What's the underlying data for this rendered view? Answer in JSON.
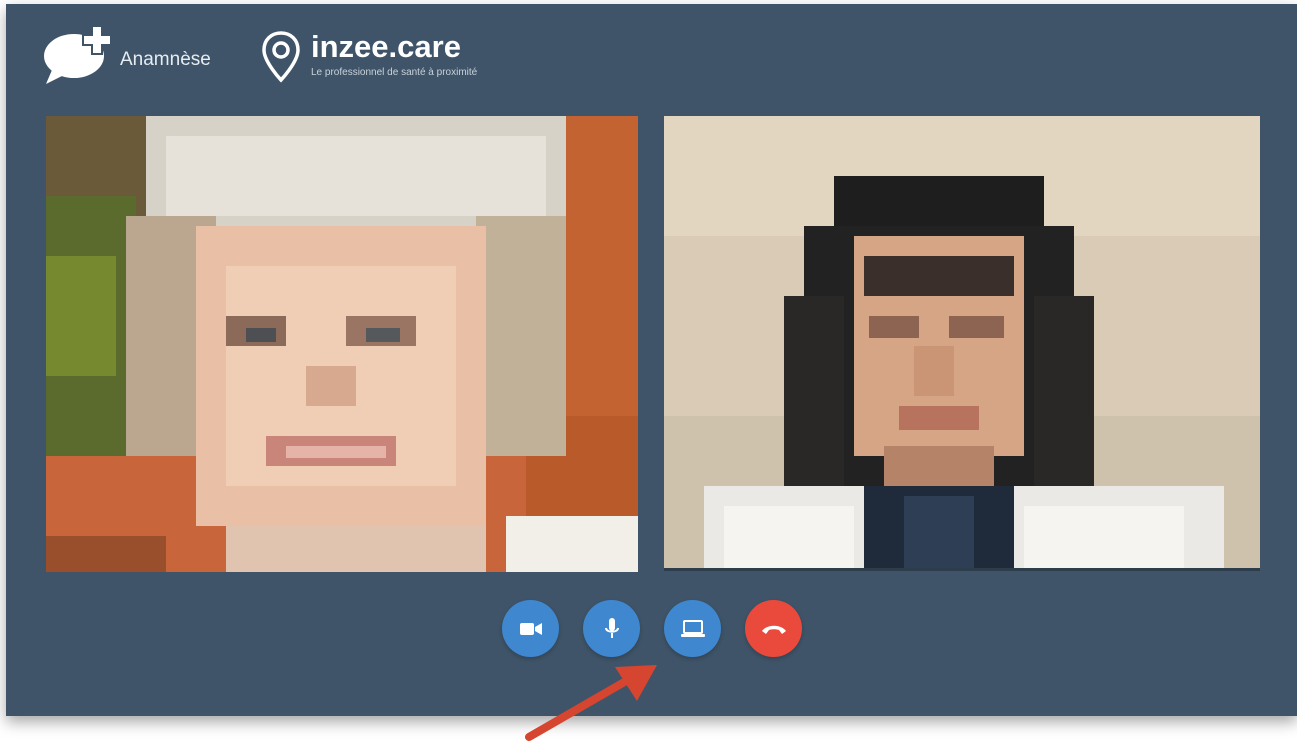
{
  "header": {
    "app_label": "Anamnèse",
    "brand_name": "inzee.care",
    "brand_tagline": "Le professionnel de santé à proximité"
  },
  "videos": {
    "remote_participant": "elderly-woman-video",
    "local_participant": "woman-doctor-video"
  },
  "controls": [
    {
      "name": "camera-toggle",
      "icon": "video-camera-icon",
      "color": "#3f88d0"
    },
    {
      "name": "microphone-toggle",
      "icon": "microphone-icon",
      "color": "#3f88d0"
    },
    {
      "name": "screen-share",
      "icon": "laptop-icon",
      "color": "#3f88d0"
    },
    {
      "name": "hang-up",
      "icon": "phone-hangup-icon",
      "color": "#ea4a3c"
    }
  ],
  "colors": {
    "background": "#3f5468",
    "accent": "#3f88d0",
    "danger": "#ea4a3c",
    "annotation_arrow": "#d6452f"
  }
}
